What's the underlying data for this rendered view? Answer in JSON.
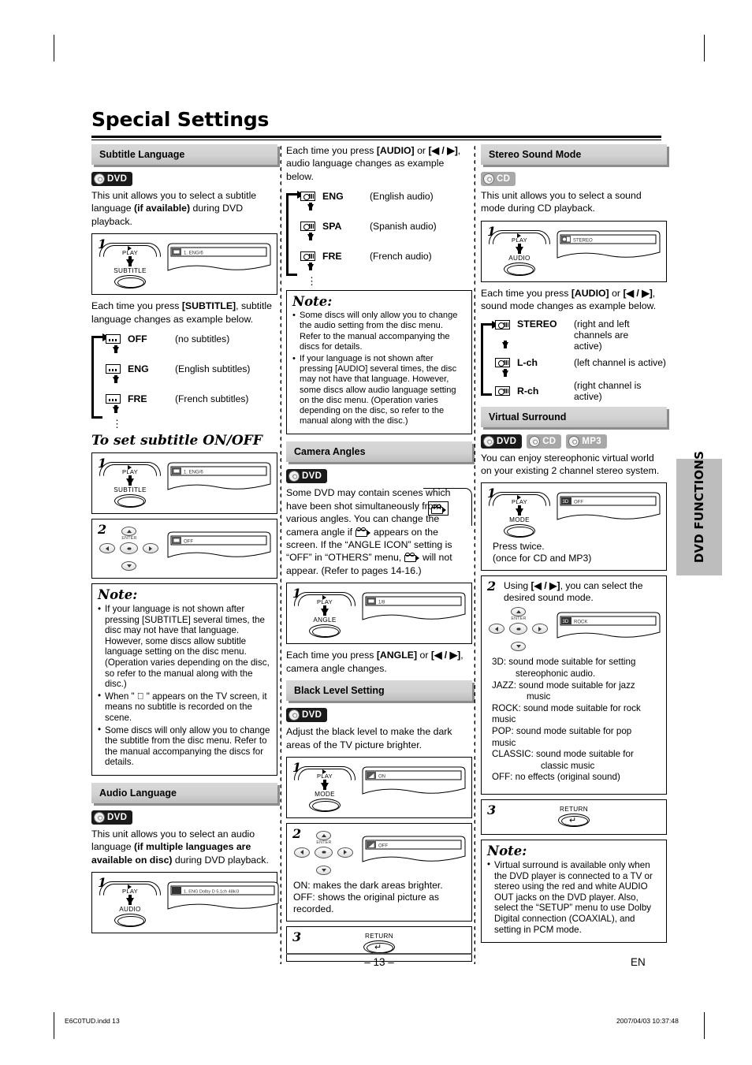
{
  "page": {
    "title": "Special Settings",
    "number": "– 13 –",
    "lang_mark": "EN",
    "side_tab": "DVD FUNCTIONS",
    "footer_left": "E6C0TUD.indd   13",
    "footer_right": "2007/04/03   10:37:48"
  },
  "badges": {
    "dvd": "DVD",
    "cd": "CD",
    "mp3": "MP3"
  },
  "keys": {
    "play": "PLAY",
    "subtitle": "SUBTITLE",
    "audio": "AUDIO",
    "angle": "ANGLE",
    "mode": "MODE",
    "return": "RETURN",
    "enter": "ENTER"
  },
  "subtitle_language": {
    "heading": "Subtitle Language",
    "intro_a": "This unit allows you to select a subtitle language ",
    "intro_b": "(if available)",
    "intro_c": " during DVD playback.",
    "step1_num": "1",
    "step1_osd": "1. ENG/6",
    "after_a": "Each time you press ",
    "after_b": "[SUBTITLE]",
    "after_c": ", subtitle language changes as example below.",
    "cycle": [
      {
        "code": "OFF",
        "desc": "(no subtitles)"
      },
      {
        "code": "ENG",
        "desc": "(English subtitles)"
      },
      {
        "code": "FRE",
        "desc": "(French subtitles)"
      }
    ],
    "onoff_heading": "To set subtitle ON/OFF",
    "onoff_step1_num": "1",
    "onoff_step1_osd": "1. ENG/6",
    "onoff_step2_num": "2",
    "onoff_step2_osd": "OFF",
    "note_title": "Note:",
    "notes": [
      "If your language is not shown after pressing [SUBTITLE] several times, the disc may not have that language. However, some discs allow subtitle language setting on the disc menu. (Operation varies depending on the disc, so refer to the manual along with the disc.)",
      "When \" ⃠ \" appears on the TV screen, it means no subtitle is recorded on the scene.",
      "Some discs will only allow you to change the subtitle from the disc menu. Refer to the manual accompanying the discs for details."
    ]
  },
  "audio_language": {
    "heading": "Audio Language",
    "intro_a": "This unit allows you to select an audio language ",
    "intro_b": "(if multiple languages are available on disc)",
    "intro_c": " during DVD playback.",
    "step1_num": "1",
    "step1_osd": "1. ENG Dolby D 5.1ch 48k/3",
    "after_a": "Each time you press ",
    "after_b": "[AUDIO]",
    "after_c": " or ",
    "after_d": "[◀ / ▶]",
    "after_e": ", audio language changes as example below.",
    "cycle": [
      {
        "code": "ENG",
        "desc": "(English audio)"
      },
      {
        "code": "SPA",
        "desc": "(Spanish audio)"
      },
      {
        "code": "FRE",
        "desc": "(French audio)"
      }
    ],
    "note_title": "Note:",
    "notes": [
      "Some discs will only allow you to change the audio setting from the disc menu. Refer to the manual accompanying the discs for details.",
      "If your language is not shown after pressing [AUDIO] several times, the disc may not have that language. However, some discs allow audio language setting on the disc menu. (Operation varies depending on the disc, so refer to the manual along with the disc.)"
    ]
  },
  "camera_angles": {
    "heading": "Camera Angles",
    "body_1": "Some DVD may contain scenes which have been shot simultaneously from various angles. You can change the camera angle if ",
    "body_2": " appears on the screen. If the “ANGLE ICON” setting is “OFF” in “OTHERS” menu, ",
    "body_3": " will not appear. (Refer to pages 14-16.)",
    "step1_num": "1",
    "step1_osd": "1/8",
    "after_a": "Each time you press ",
    "after_b": "[ANGLE]",
    "after_c": " or ",
    "after_d": "[◀ / ▶]",
    "after_e": ", camera angle changes."
  },
  "black_level": {
    "heading": "Black Level Setting",
    "intro": "Adjust the black level to make the dark areas of the TV picture brighter.",
    "step1_num": "1",
    "step1_osd": "ON",
    "step2_num": "2",
    "step2_osd": "OFF",
    "def_on": "ON: makes the dark areas brighter.",
    "def_off": "OFF: shows the original picture as recorded.",
    "step3_num": "3"
  },
  "stereo_sound_mode": {
    "heading": "Stereo Sound Mode",
    "intro": "This unit allows you to select a sound mode during CD playback.",
    "step1_num": "1",
    "step1_osd": "STEREO",
    "after_a": "Each time you press ",
    "after_b": "[AUDIO]",
    "after_c": " or ",
    "after_d": "[◀ / ▶]",
    "after_e": ", sound mode changes as example below.",
    "cycle": [
      {
        "code": "STEREO",
        "desc": "(right and left channels are active)"
      },
      {
        "code": "L-ch",
        "desc": "(left channel is active)"
      },
      {
        "code": "R-ch",
        "desc": "(right channel is active)"
      }
    ]
  },
  "virtual_surround": {
    "heading": "Virtual Surround",
    "intro": "You can enjoy stereophonic virtual world on your existing 2 channel stereo system.",
    "step1_num": "1",
    "step1_osd": "OFF",
    "step1_note_a": "Press twice.",
    "step1_note_b": "(once for CD and MP3)",
    "step2_num": "2",
    "step2_text_a": "Using ",
    "step2_text_b": "[◀ / ▶]",
    "step2_text_c": ", you can select the desired sound mode.",
    "step2_osd": "ROCK",
    "modes": [
      {
        "label": "3D: sound mode suitable for setting",
        "cont": "stereophonic audio."
      },
      {
        "label": "JAZZ: sound mode suitable for jazz",
        "cont": "music"
      },
      {
        "label": "ROCK: sound mode suitable for rock music",
        "cont": ""
      },
      {
        "label": "POP: sound mode suitable for pop music",
        "cont": ""
      },
      {
        "label": "CLASSIC: sound mode suitable for",
        "cont": "classic music"
      },
      {
        "label": "OFF: no effects (original sound)",
        "cont": ""
      }
    ],
    "step3_num": "3",
    "note_title": "Note:",
    "notes": [
      "Virtual surround is available only when the DVD player is connected to a TV or stereo using the red and white AUDIO OUT jacks on the DVD player. Also, select the “SETUP” menu to use Dolby Digital connection (COAXIAL), and setting in PCM mode."
    ]
  }
}
